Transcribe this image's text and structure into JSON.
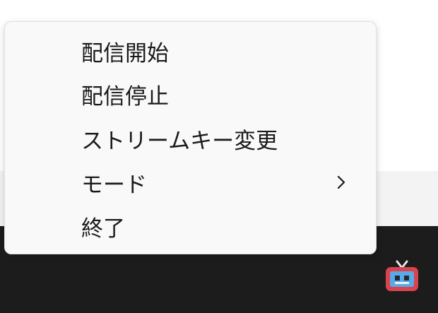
{
  "context_menu": {
    "items": [
      {
        "label": "配信開始",
        "has_submenu": false
      },
      {
        "label": "配信停止",
        "has_submenu": false
      },
      {
        "label": "ストリームキー変更",
        "has_submenu": false
      },
      {
        "label": "モード",
        "has_submenu": true
      },
      {
        "label": "終了",
        "has_submenu": false
      }
    ]
  },
  "taskbar": {
    "tray_icon": "tv-icon"
  },
  "colors": {
    "menu_bg": "#f9f9f9",
    "taskbar_bg": "#1c1c1c",
    "tv_frame": "#d9434f",
    "tv_screen": "#5aa9e6"
  }
}
